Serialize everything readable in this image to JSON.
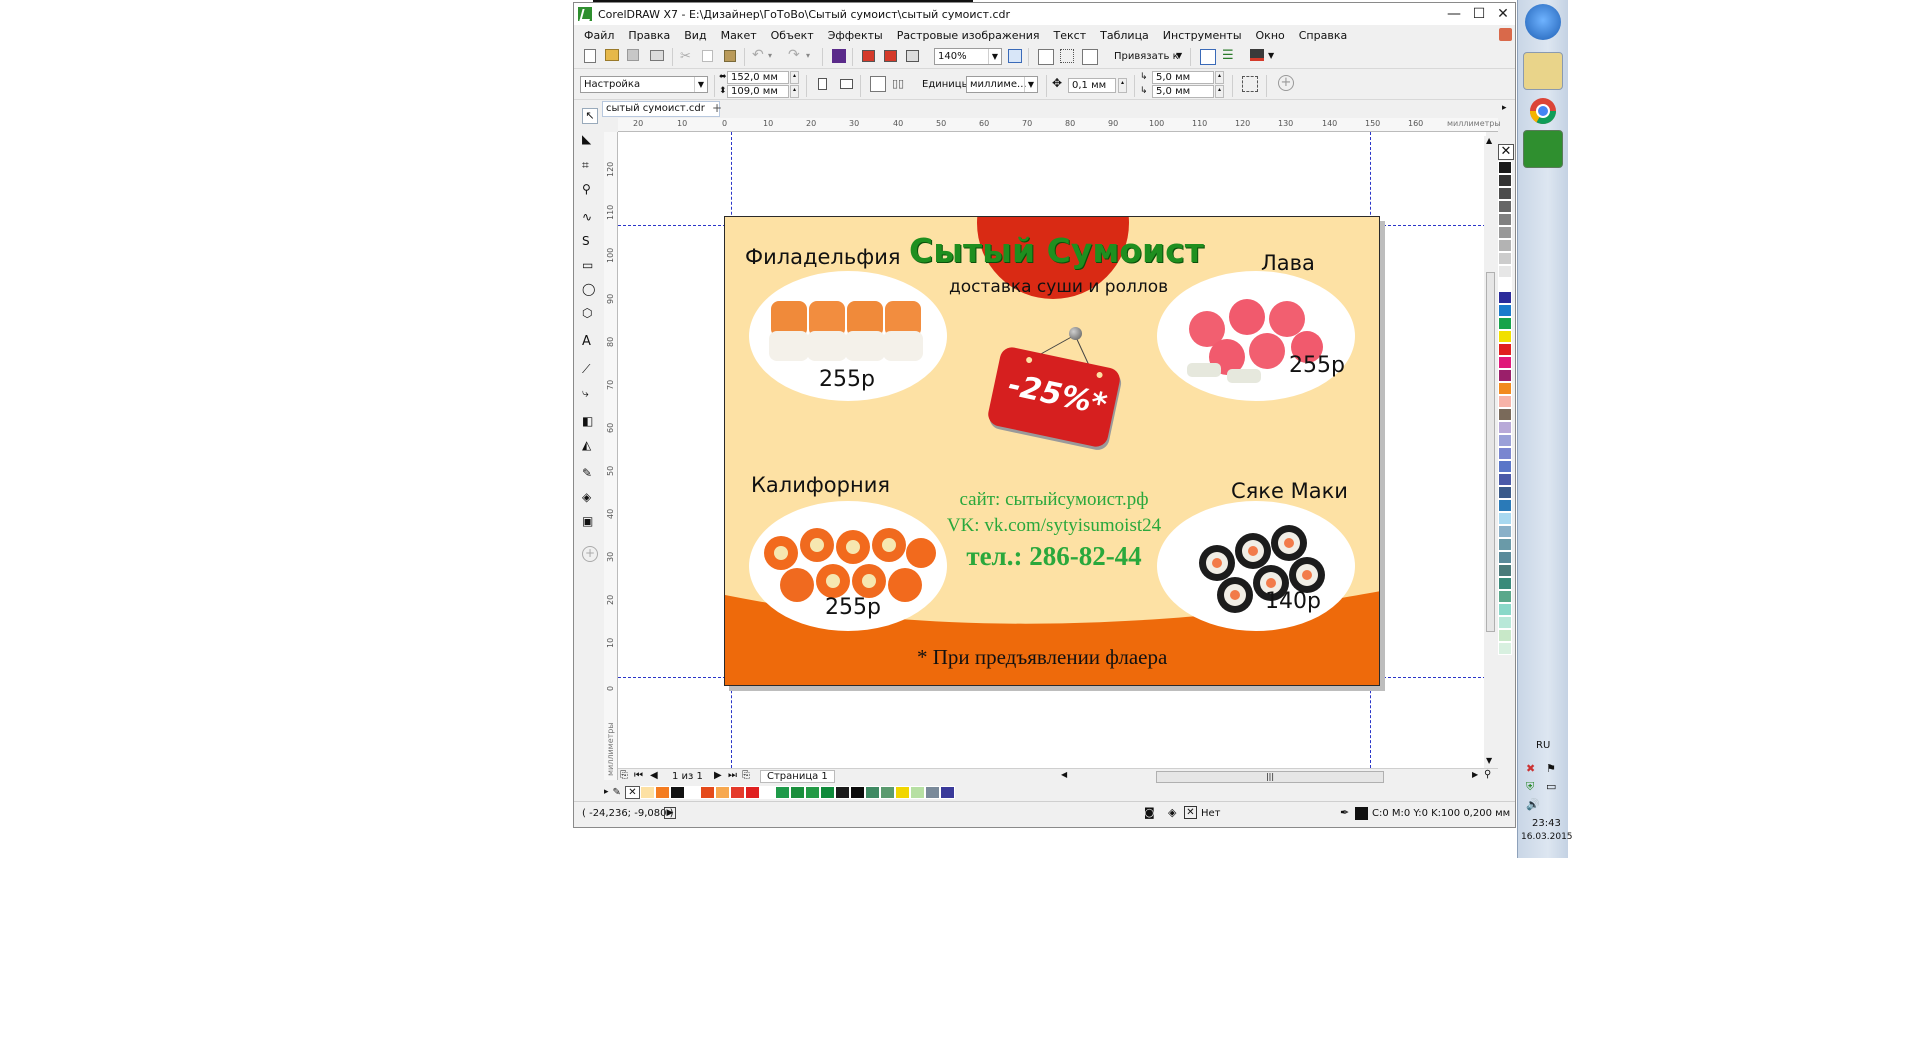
{
  "window": {
    "title": "CorelDRAW X7 - E:\\Дизайнер\\ГоТоВо\\Сытый сумоист\\сытый сумоист.cdr",
    "minimize": "—",
    "maximize": "☐",
    "close": "✕"
  },
  "menu": [
    "Файл",
    "Правка",
    "Вид",
    "Макет",
    "Объект",
    "Эффекты",
    "Растровые изображения",
    "Текст",
    "Таблица",
    "Инструменты",
    "Окно",
    "Справка"
  ],
  "toolbar": {
    "zoom_value": "140%",
    "snap_label": "Привязать к"
  },
  "propbar": {
    "preset_value": "Настройка",
    "width_value": "152,0 мм",
    "height_value": "109,0 мм",
    "units_label": "Единицы:",
    "units_value": "миллиме...",
    "nudge_value": "0,1 мм",
    "dup_x_value": "5,0 мм",
    "dup_y_value": "5,0 мм"
  },
  "document_tab": "сытый сумоист.cdr",
  "ruler": {
    "units": "миллиметры",
    "h_ticks": [
      "20",
      "10",
      "0",
      "10",
      "20",
      "30",
      "40",
      "50",
      "60",
      "70",
      "80",
      "90",
      "100",
      "110",
      "120",
      "130",
      "140",
      "150",
      "160"
    ],
    "v_ticks": [
      "120",
      "110",
      "100",
      "90",
      "80",
      "70",
      "60",
      "50",
      "40",
      "30",
      "20",
      "10",
      "0"
    ]
  },
  "flyer": {
    "title": "Сытый Сумоист",
    "subtitle": "доставка суши и роллов",
    "discount": "-25%*",
    "items": [
      {
        "name": "Филадельфия",
        "price": "255р"
      },
      {
        "name": "Лава",
        "price": "255р"
      },
      {
        "name": "Калифорния",
        "price": "255р"
      },
      {
        "name": "Сяке Маки",
        "price": "140р"
      }
    ],
    "site": "сайт: сытыйсумоист.рф",
    "vk": "VK: vk.com/sytyisumoist24",
    "phone": "тел.: 286-82-44",
    "note": "* При предъявлении флаера",
    "colors": {
      "background": "#fde1a4",
      "orange": "#ee6a0b",
      "red": "#d92a14",
      "green": "#2aa83c",
      "title_green": "#1f8f1f"
    }
  },
  "pager": {
    "page_count": "1 из 1",
    "page_tab": "Страница 1"
  },
  "status": {
    "coords": "( -24,236; -9,080 )",
    "fill_none": "Нет",
    "outline_info": "C:0 M:0 Y:0 K:100  0,200 мм"
  },
  "palette_h": [
    "#fde1a4",
    "#f47c20",
    "#111111",
    "#ffffff",
    "#e54a1a",
    "#f7a84f",
    "#e53a2a",
    "#e02020",
    "#ffffff",
    "#1e9a49",
    "#1a8f3c",
    "#239a45",
    "#0f8a3a",
    "#1b1b1b",
    "#0b0b0b",
    "#3f8a63",
    "#5b9b6f",
    "#f1d600",
    "#b7e0a3",
    "#7a8a9a",
    "#3a3a9a"
  ],
  "palette_v": [
    "#1a1a1a",
    "#333333",
    "#4d4d4d",
    "#666666",
    "#808080",
    "#999999",
    "#b3b3b3",
    "#cccccc",
    "#e6e6e6",
    "#ffffff",
    "#2a2a9a",
    "#1a7acb",
    "#16a34a",
    "#f1e000",
    "#e01e1e",
    "#e0187a",
    "#9a1f6a",
    "#f28a1e",
    "#f7b3a8",
    "#7a6a5a",
    "#b8a9d8",
    "#9aa0d8",
    "#7a86d0",
    "#5a76c8",
    "#4a5aa8",
    "#3a5a8a",
    "#2a7ab8",
    "#a8d8f0",
    "#8ab0c8",
    "#6a9aa8",
    "#5a8a9a",
    "#4a7a7a",
    "#3a8a7a",
    "#5aa88a",
    "#8ad8c8",
    "#b8e8d8",
    "#c8e8c8",
    "#d8f0e0"
  ],
  "taskbar": {
    "lang": "RU",
    "time": "23:43",
    "date": "16.03.2015"
  }
}
